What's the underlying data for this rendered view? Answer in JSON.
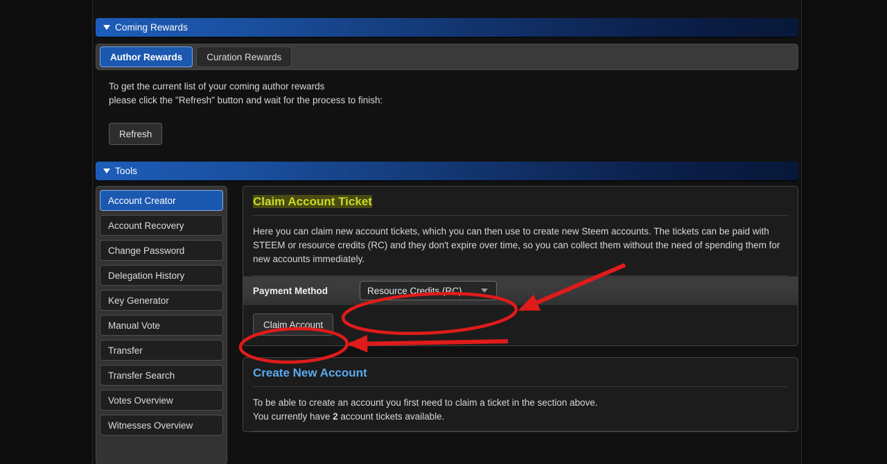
{
  "sections": {
    "coming_rewards": {
      "title": "Coming Rewards",
      "caret": "caret-down-icon",
      "tabs": [
        {
          "label": "Author Rewards",
          "active": true
        },
        {
          "label": "Curation Rewards",
          "active": false
        }
      ],
      "hint_line_1": "To get the current list of your coming author rewards",
      "hint_line_2": "please click the \"Refresh\" button and wait for the process to finish:",
      "refresh_label": "Refresh"
    },
    "tools": {
      "title": "Tools",
      "caret": "caret-down-icon",
      "sidebar_items": [
        {
          "label": "Account Creator",
          "active": true
        },
        {
          "label": "Account Recovery",
          "active": false
        },
        {
          "label": "Change Password",
          "active": false
        },
        {
          "label": "Delegation History",
          "active": false
        },
        {
          "label": "Key Generator",
          "active": false
        },
        {
          "label": "Manual Vote",
          "active": false
        },
        {
          "label": "Transfer",
          "active": false
        },
        {
          "label": "Transfer Search",
          "active": false
        },
        {
          "label": "Votes Overview",
          "active": false
        },
        {
          "label": "Witnesses Overview",
          "active": false
        }
      ],
      "claim_card": {
        "title": "Claim Account Ticket",
        "description": "Here you can claim new account tickets, which you can then use to create new Steem accounts. The tickets can be paid with STEEM or resource credits (RC) and they don't expire over time, so you can collect them without the need of spending them for new accounts immediately.",
        "payment_label": "Payment Method",
        "payment_value": "Resource Credits (RC)",
        "payment_options": [
          "Resource Credits (RC)"
        ],
        "claim_button_label": "Claim Account"
      },
      "create_card": {
        "title": "Create New Account",
        "line_1": "To be able to create an account you first need to claim a ticket in the section above.",
        "line_2_prefix": "You currently have ",
        "tickets_count": "2",
        "line_2_suffix": " account tickets available."
      }
    }
  },
  "annotations": {
    "color": "#e01b1b",
    "items": [
      {
        "name": "ellipse-around-payment-dropdown"
      },
      {
        "name": "arrow-to-payment-dropdown"
      },
      {
        "name": "ellipse-around-claim-account-button"
      },
      {
        "name": "arrow-to-claim-account-button"
      }
    ]
  },
  "colors": {
    "page_bg": "#0d0d0d",
    "panel_bg": "#111111",
    "accent_blue": "#1b58b0",
    "header_gradient_start": "#1d5db9",
    "header_gradient_end": "#081839",
    "highlight_bg": "#4a4a12",
    "highlight_text": "#c8dc28",
    "card_title_blue": "#5aaaf0",
    "annotation_red": "#e01b1b"
  }
}
